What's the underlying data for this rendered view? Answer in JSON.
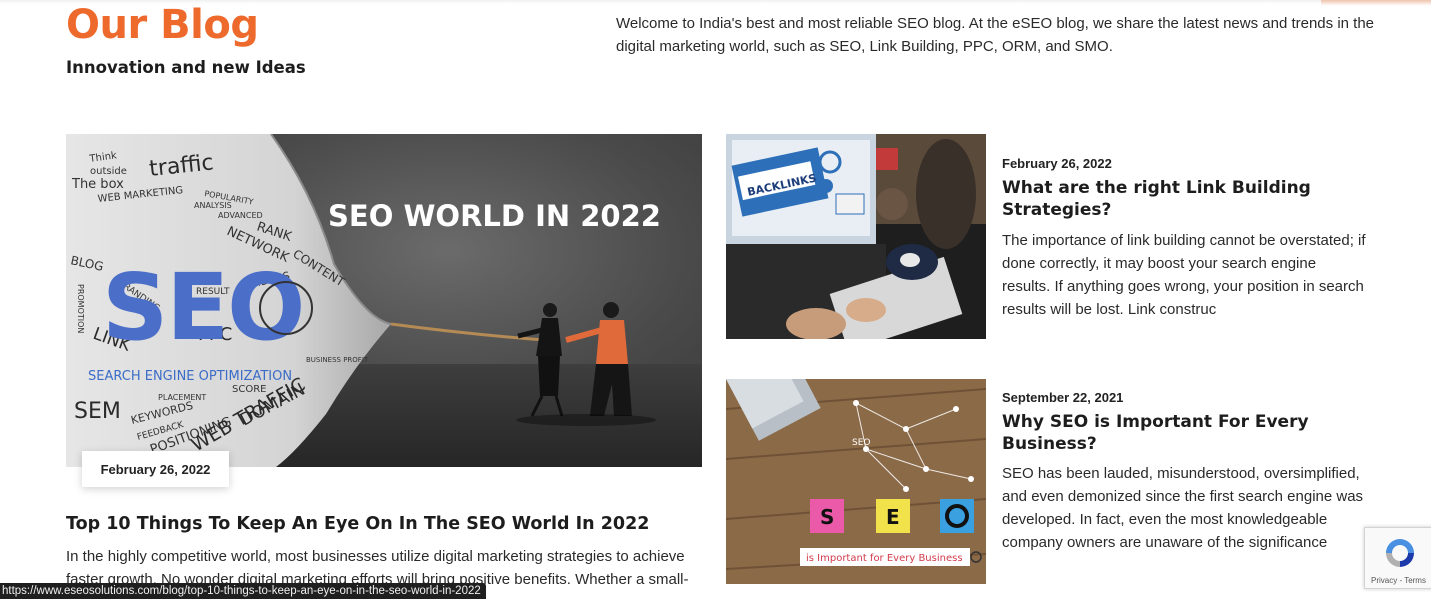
{
  "header": {
    "title": "Our Blog",
    "subtitle": "Innovation and new Ideas",
    "intro": "Welcome to India's best and most reliable SEO blog. At the eSEO blog, we share the latest news and trends in the digital marketing world, such as SEO, Link Building, PPC, ORM, and SMO."
  },
  "featured": {
    "image_caption": "SEO WORLD IN 2022",
    "image_words": [
      "Think",
      "outside",
      "The box",
      "traffic",
      "WEB MARKETING",
      "POPULARITY",
      "ANALYSIS",
      "ADVANCED",
      "RANK",
      "NETWORK",
      "CONTENT",
      "BLOG",
      "BRANDING",
      "RESULT",
      "IDEAS",
      "LINK",
      "PPC",
      "PROMOTION",
      "SEO",
      "SEARCH ENGINE OPTIMIZATION",
      "SCORE",
      "SEM",
      "PLACEMENT",
      "KEYWORDS",
      "DOMAIN",
      "FEEDBACK",
      "POSITIONING",
      "WEB TRAFFIC",
      "BUSINESS PROFIT"
    ],
    "date": "February 26, 2022",
    "title": "Top 10 Things To Keep An Eye On In The SEO World In 2022",
    "excerpt": "In the highly competitive world, most businesses utilize digital marketing strategies to achieve faster growth. No wonder digital marketing efforts will bring positive benefits. Whether a small-"
  },
  "posts": [
    {
      "date": "February 26, 2022",
      "title": "What are the right Link Building Strategies?",
      "excerpt": "The importance of link building cannot be overstated; if done correctly, it may boost your search engine results. If anything goes wrong, your position in search results will be lost. Link construc",
      "image_text": "BACKLINKS"
    },
    {
      "date": "September 22, 2021",
      "title": "Why SEO is Important For Every Business?",
      "excerpt": "SEO has been lauded, misunderstood, oversimplified, and even demonized since the first search engine was developed. In fact, even the most knowledgeable company owners are unaware of the significance",
      "image_text": "is Important for Every Business",
      "image_letters": [
        "S",
        "E",
        "SEO"
      ]
    }
  ],
  "status_url": "https://www.eseosolutions.com/blog/top-10-things-to-keep-an-eye-on-in-the-seo-world-in-2022",
  "recaptcha": {
    "links": "Privacy - Terms"
  },
  "colors": {
    "accent": "#ee6a2c",
    "text": "#1d1d1d",
    "status_bg": "#1f1f1f"
  }
}
